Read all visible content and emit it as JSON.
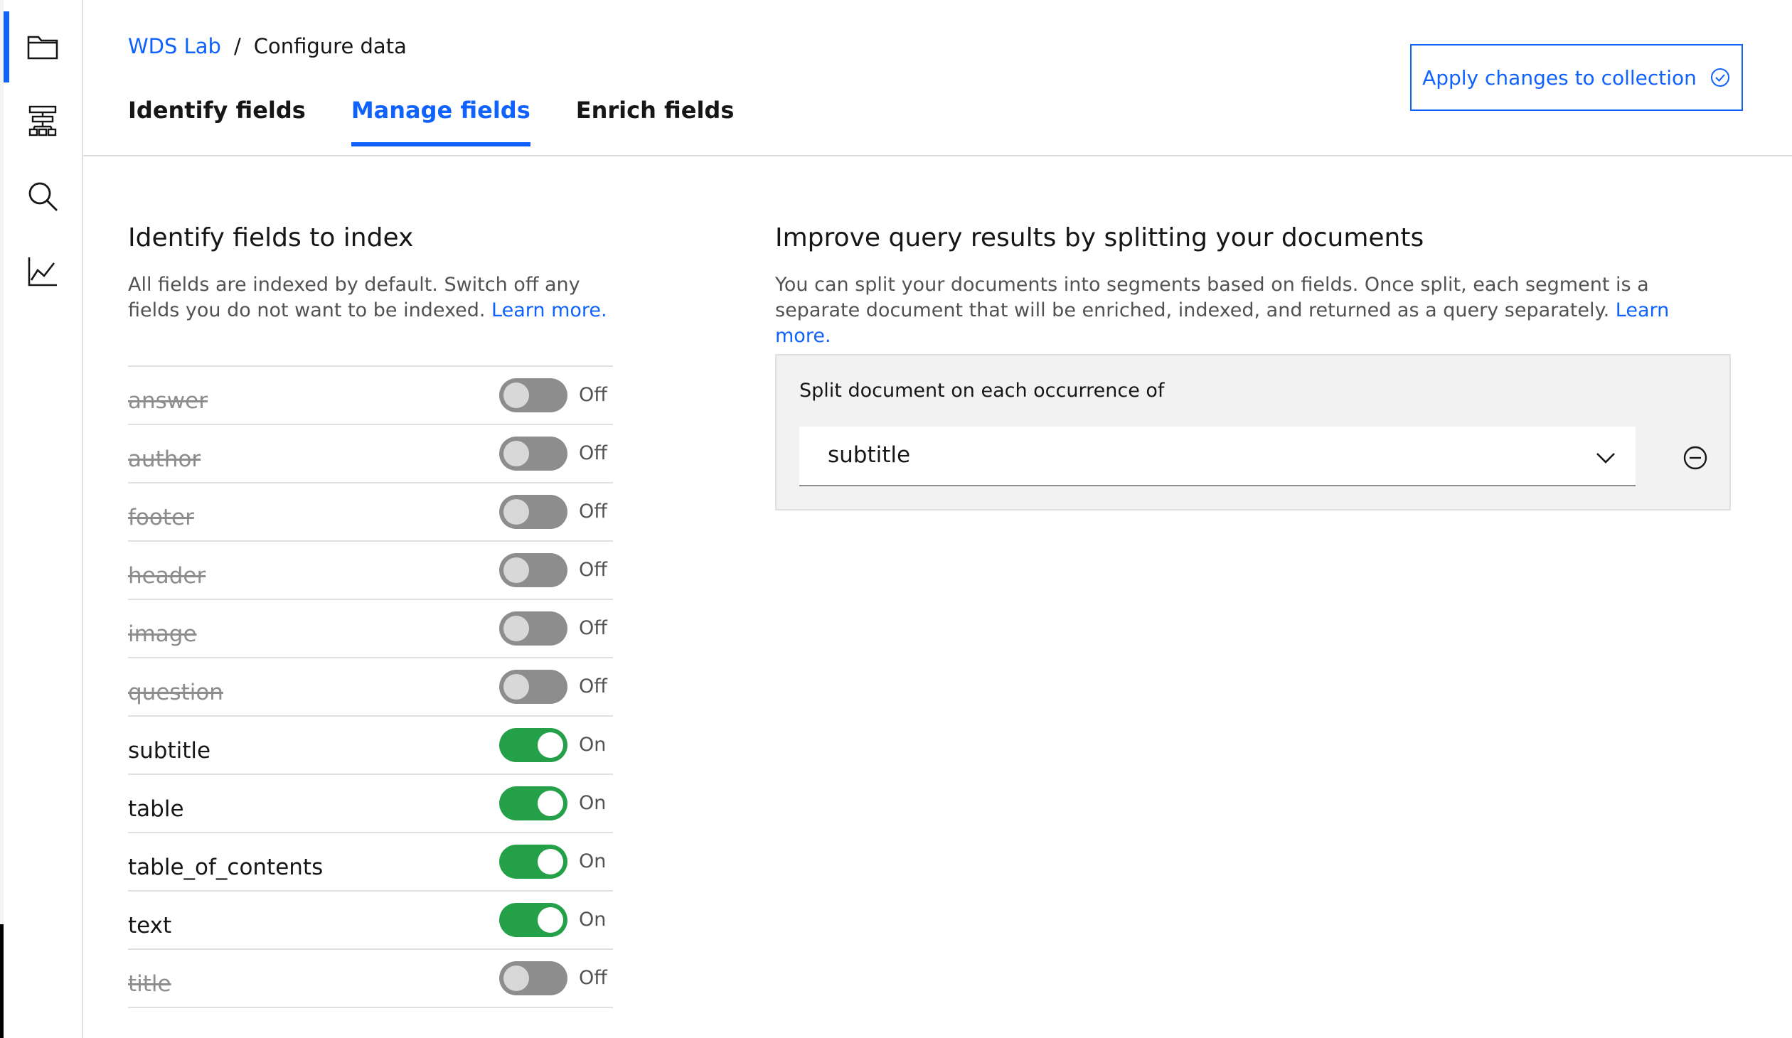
{
  "breadcrumb": {
    "root": "WDS Lab",
    "separator": "/",
    "current": "Configure data"
  },
  "tabs": [
    {
      "label": "Identify fields",
      "active": false
    },
    {
      "label": "Manage fields",
      "active": true
    },
    {
      "label": "Enrich fields",
      "active": false
    }
  ],
  "apply_button": {
    "label": "Apply changes to collection",
    "icon": "checkmark-outline-icon"
  },
  "rail": [
    {
      "icon": "folder-icon",
      "active": true
    },
    {
      "icon": "data-structure-icon",
      "active": false
    },
    {
      "icon": "search-icon",
      "active": false
    },
    {
      "icon": "analytics-chart-icon",
      "active": false
    }
  ],
  "index_section": {
    "title": "Identify fields to index",
    "description": "All fields are indexed by default. Switch off any fields you do not want to be indexed.",
    "learn_more": "Learn more."
  },
  "fields": [
    {
      "name": "answer",
      "on": false,
      "state": "Off"
    },
    {
      "name": "author",
      "on": false,
      "state": "Off"
    },
    {
      "name": "footer",
      "on": false,
      "state": "Off"
    },
    {
      "name": "header",
      "on": false,
      "state": "Off"
    },
    {
      "name": "image",
      "on": false,
      "state": "Off"
    },
    {
      "name": "question",
      "on": false,
      "state": "Off"
    },
    {
      "name": "subtitle",
      "on": true,
      "state": "On"
    },
    {
      "name": "table",
      "on": true,
      "state": "On"
    },
    {
      "name": "table_of_contents",
      "on": true,
      "state": "On"
    },
    {
      "name": "text",
      "on": true,
      "state": "On"
    },
    {
      "name": "title",
      "on": false,
      "state": "Off"
    }
  ],
  "split_section": {
    "title": "Improve query results by splitting your documents",
    "description": "You can split your documents into segments based on fields. Once split, each segment is a separate document that will be enriched, indexed, and returned as a query separately.",
    "learn_more": "Learn more.",
    "split_label": "Split document on each occurrence of",
    "selected_field": "subtitle"
  },
  "colors": {
    "accent": "#0f62fe",
    "toggle_on": "#24a148",
    "toggle_off": "#8d8d8d"
  }
}
